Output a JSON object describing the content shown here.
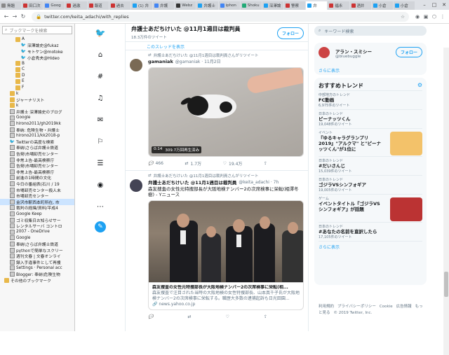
{
  "tabs": [
    {
      "label": "無題",
      "active": false
    },
    {
      "label": "田口次",
      "active": false
    },
    {
      "label": "Goog",
      "active": false
    },
    {
      "label": "過激",
      "active": false
    },
    {
      "label": "報道",
      "active": false
    },
    {
      "label": "過去",
      "active": false
    },
    {
      "label": "(1) 弁",
      "active": false
    },
    {
      "label": "弁護",
      "active": false
    },
    {
      "label": "Webz",
      "active": false
    },
    {
      "label": "弁護士",
      "active": false
    },
    {
      "label": "iphon",
      "active": false
    },
    {
      "label": "Shoku",
      "active": false
    },
    {
      "label": "深澤論",
      "active": false
    },
    {
      "label": "警察",
      "active": false
    },
    {
      "label": "弁",
      "active": true
    },
    {
      "label": "福永",
      "active": false
    },
    {
      "label": "酒井",
      "active": false
    },
    {
      "label": "小倉",
      "active": false
    },
    {
      "label": "小倉",
      "active": false
    }
  ],
  "address": {
    "url": "twitter.com/keita_adachi/with_replies"
  },
  "bookmarks": {
    "search_placeholder": "ブックマークを検索",
    "items": [
      {
        "label": "A",
        "type": "folder",
        "indent": 2
      },
      {
        "label": "深澤論史@fukaz",
        "type": "tw",
        "indent": 3
      },
      {
        "label": "モトケン@motoke",
        "type": "tw",
        "indent": 3
      },
      {
        "label": "小倉秀夫@Hideo",
        "type": "tw",
        "indent": 3
      },
      {
        "label": "B",
        "type": "folder",
        "indent": 2
      },
      {
        "label": "C",
        "type": "folder",
        "indent": 2
      },
      {
        "label": "D",
        "type": "folder",
        "indent": 2
      },
      {
        "label": "E",
        "type": "folder",
        "indent": 2
      },
      {
        "label": "F",
        "type": "folder",
        "indent": 2
      },
      {
        "label": "k",
        "type": "folder",
        "indent": 1
      },
      {
        "label": "ジャーナリスト",
        "type": "folder",
        "indent": 1
      },
      {
        "label": "k",
        "type": "folder",
        "indent": 1
      },
      {
        "label": "弁護士 深澤論史のブログ",
        "type": "pg",
        "indent": 1
      },
      {
        "label": "Google",
        "type": "pg",
        "indent": 1
      },
      {
        "label": "hirono2011/gh2019kk",
        "type": "pg",
        "indent": 1
      },
      {
        "label": "奉納: 危険生物・弁護士",
        "type": "pg",
        "indent": 1
      },
      {
        "label": "hirono2011/kk2018-p",
        "type": "pg",
        "indent": 1
      },
      {
        "label": "Twitterの高度な検索",
        "type": "tw",
        "indent": 1
      },
      {
        "label": "奉納\\さらば弁護士鉄道",
        "type": "pg",
        "indent": 1
      },
      {
        "label": "告発\\市場卸売センター",
        "type": "pg",
        "indent": 1
      },
      {
        "label": "非常上告-最高検察庁",
        "type": "pg",
        "indent": 1
      },
      {
        "label": "告発\\市場卸売センター",
        "type": "pg",
        "indent": 1
      },
      {
        "label": "非常上告-最高検察庁",
        "type": "pg",
        "indent": 1
      },
      {
        "label": "前進の1時間の文化",
        "type": "pg",
        "indent": 1
      },
      {
        "label": "今日の番組表(石川 / 19",
        "type": "pg",
        "indent": 1
      },
      {
        "label": "市場卸売センター殺人未",
        "type": "pg",
        "indent": 1
      },
      {
        "label": "市場卸売センター",
        "type": "pg",
        "indent": 1
      },
      {
        "label": "金沢市駅西本町所在, 市",
        "type": "pg",
        "indent": 1,
        "selected": true
      },
      {
        "label": "裁判の経緯/資料/平成4",
        "type": "pg",
        "indent": 1
      },
      {
        "label": "Google Keep",
        "type": "pg",
        "indent": 1
      },
      {
        "label": "ゴミ収集日お知らせサー",
        "type": "pg",
        "indent": 1
      },
      {
        "label": "レンタルサーバ コントロ",
        "type": "pg",
        "indent": 1
      },
      {
        "label": "2007 - OneDrive",
        "type": "pg",
        "indent": 1
      },
      {
        "label": "Google",
        "type": "pg",
        "indent": 1
      },
      {
        "label": "奉納\\さらば弁護士鉄道",
        "type": "pg",
        "indent": 1
      },
      {
        "label": "pythonで簡単なスクリー",
        "type": "pg",
        "indent": 1
      },
      {
        "label": "週刊文春 | 文春オンライ",
        "type": "pg",
        "indent": 1
      },
      {
        "label": "録入手違事件として再捜",
        "type": "pg",
        "indent": 1
      },
      {
        "label": "Settings · Personal acc",
        "type": "pg",
        "indent": 1
      },
      {
        "label": "Blogger: 奉納\\危険生物",
        "type": "pg",
        "indent": 1
      },
      {
        "label": "その他のブックマーク",
        "type": "folder",
        "indent": 0
      }
    ]
  },
  "header": {
    "name": "弁護士あだちけいた @11月1週目は裁判員",
    "sub": "18.3万件のツイート",
    "follow": "フォロー"
  },
  "show_thread": "このスレッドを表示",
  "tweets": [
    {
      "rt": "弁護士あだちけいた @11月1週目は裁判員さんがリツイート",
      "name": "gamaniak",
      "handle": "@gamaniak · 11月2日",
      "video_time": "0:14",
      "video_views": "309.7万回再生済み",
      "replies": "466",
      "retweets": "1.7万",
      "likes": "19.4万"
    },
    {
      "rt": "弁護士あだちけいた @11月1週目は裁判員さんがリツイート",
      "name": "弁護士あだちけいた @11月1週目は裁判員",
      "handle": "@keita_adachi · 7h",
      "text": "森友捜査の女性元特捜部長が大阪地検ナンバー2の次席検事に栄転(相澤冬樹) - Yニュース",
      "card_title": "森友捜査の女性元特捜部長が大阪地検ナンバー2の次席検事に栄転(相...",
      "card_desc": "森友捜査で注目された当時の大阪地検の女性特捜部長、山本真千子氏が大阪地検ナンバー2の次席検事に栄転する。職歴大多数の逮捕起訴も日光田園...",
      "card_link": "news.yahoo.co.jp",
      "replies": "",
      "retweets": "",
      "likes": ""
    }
  ],
  "sidebar_right": {
    "search_placeholder": "キーワード検索",
    "wtf": {
      "name": "アラン・スミシー",
      "handle": "@bluebuggle",
      "follow": "フォロー",
      "more": "さらに表示"
    },
    "trends_title": "おすすめトレンド",
    "trends": [
      {
        "cat": "中部地方のトレンド",
        "name": "FC動画",
        "count": "6,975件のツイート"
      },
      {
        "cat": "日本のトレンド",
        "name": "ピーナッツくん",
        "count": "19,048件のツイート"
      },
      {
        "cat": "イベント",
        "name": "『ゆるキャラグランプリ2019』\"アルクマ\" と\"ピーナッツくん\"が1位に",
        "count": "",
        "img": "#f3c26a"
      },
      {
        "cat": "日本のトレンド",
        "name": "#だいさんじ",
        "count": "15,039件のツイート"
      },
      {
        "cat": "日本のトレンド",
        "name": "ゴジラVSシンフォギア",
        "count": "19,005件のツイート"
      },
      {
        "cat": "ゲーム",
        "name": "イベントタイトル『ゴジラVSシンフォギア』が話題",
        "count": "",
        "img": "#b33"
      },
      {
        "cat": "日本のトレンド",
        "name": "#あなたの名前を直訳したら",
        "count": "17,105件のツイート"
      }
    ],
    "trends_more": "さらに表示",
    "footer": [
      "利用規約",
      "プライバシーポリシー",
      "Cookie",
      "広告情報",
      "もっと見る",
      "© 2019 Twitter, Inc."
    ]
  }
}
